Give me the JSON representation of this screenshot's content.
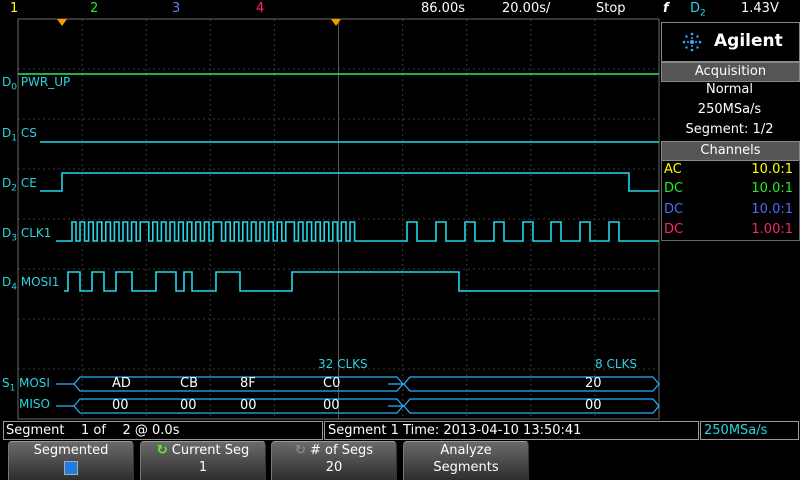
{
  "top": {
    "ch1": "1",
    "ch2": "2",
    "ch3": "3",
    "ch4": "4",
    "delay": "86.00s",
    "timebase": "20.00s/",
    "run_state": "Stop",
    "trig_icon": "f",
    "trig_source": "D",
    "trig_source_sub": "2",
    "trig_level": "1.43V"
  },
  "brand": {
    "name": "Agilent"
  },
  "acquisition": {
    "title": "Acquisition",
    "mode": "Normal",
    "rate": "250MSa/s",
    "segment": "Segment: 1/2"
  },
  "channels": {
    "title": "Channels",
    "rows": [
      {
        "coupling": "AC",
        "probe": "10.0:1",
        "color": "#ffff00"
      },
      {
        "coupling": "DC",
        "probe": "10.0:1",
        "color": "#22ee22"
      },
      {
        "coupling": "DC",
        "probe": "10.0:1",
        "color": "#5566ff"
      },
      {
        "coupling": "DC",
        "probe": "1.00:1",
        "color": "#ff2277"
      }
    ]
  },
  "digital": {
    "d0": {
      "prefix": "D",
      "sub": "0",
      "name": "PWR_UP"
    },
    "d1": {
      "prefix": "D",
      "sub": "1",
      "name": "CS"
    },
    "d2": {
      "prefix": "D",
      "sub": "2",
      "name": "CE"
    },
    "d3": {
      "prefix": "D",
      "sub": "3",
      "name": "CLK1"
    },
    "d4": {
      "prefix": "D",
      "sub": "4",
      "name": "MOSI1"
    }
  },
  "serial": {
    "prefix": "S",
    "sub": "1",
    "mosi_label": "MOSI",
    "miso_label": "MISO",
    "clk_note_1": "32 CLKS",
    "clk_note_2": "8 CLKS",
    "mosi_bytes": [
      "AD",
      "CB",
      "8F",
      "C0",
      "20"
    ],
    "miso_bytes": [
      "00",
      "00",
      "00",
      "00",
      "00"
    ]
  },
  "status": {
    "segment": "Segment    1 of    2 @ 0.0s",
    "segtime": "Segment 1 Time: 2013-04-10 13:50:41",
    "rate": "250MSa/s"
  },
  "softkeys": {
    "segmented": "Segmented",
    "current_seg": "Current Seg",
    "current_seg_value": "1",
    "num_segs": "# of Segs",
    "num_segs_value": "20",
    "analyze_line1": "Analyze",
    "analyze_line2": "Segments"
  },
  "colors": {
    "ch1": "#ff9900",
    "ch2": "#22ee22",
    "ch3": "#5566ff",
    "ch4": "#ff2277",
    "digital_trace": "#22d8e8",
    "digital_high": "#22ee66",
    "bus": "#2ab0ff"
  }
}
